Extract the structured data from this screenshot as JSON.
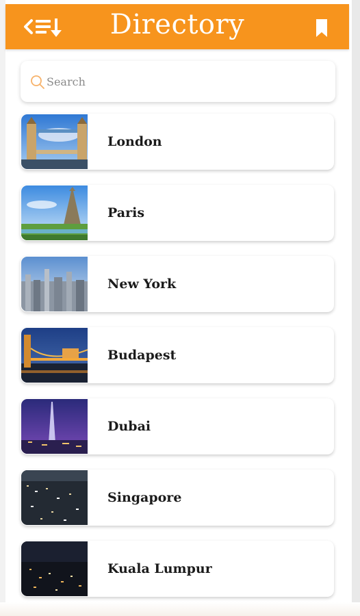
{
  "header": {
    "title": "Directory",
    "color": "#f7941d",
    "left_icon": "back-sort-icon",
    "right_icon": "bookmark-icon"
  },
  "search": {
    "placeholder": "Search",
    "icon": "search-icon",
    "icon_color": "#f7941d"
  },
  "cities": [
    {
      "name": "London",
      "image": "tower-bridge-photo"
    },
    {
      "name": "Paris",
      "image": "eiffel-tower-photo"
    },
    {
      "name": "New York",
      "image": "manhattan-skyline-photo"
    },
    {
      "name": "Budapest",
      "image": "chain-bridge-night-photo"
    },
    {
      "name": "Dubai",
      "image": "burj-khalifa-night-photo"
    },
    {
      "name": "Singapore",
      "image": "city-night-aerial-photo"
    },
    {
      "name": "Kuala Lumpur",
      "image": "city-night-lights-photo"
    }
  ]
}
